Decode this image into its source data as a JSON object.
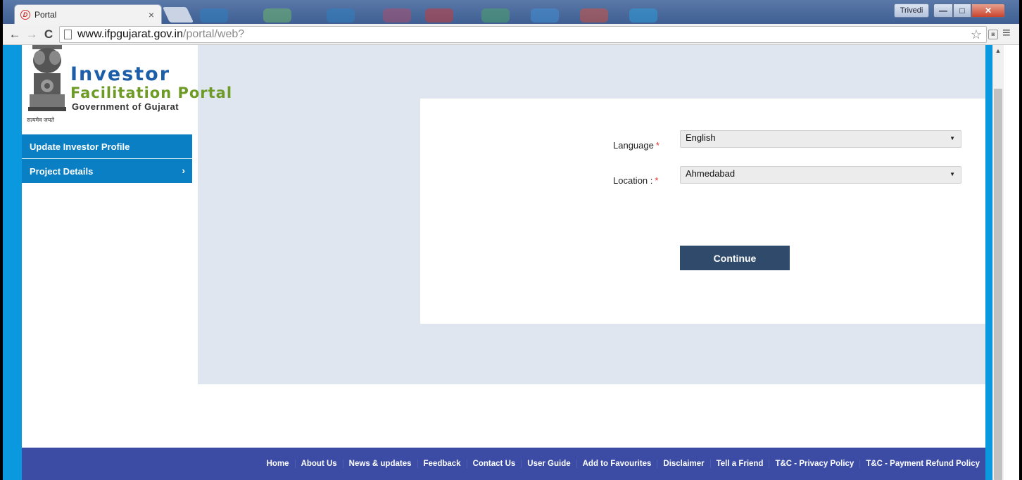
{
  "browser": {
    "tab_title": "Portal",
    "tab_favicon": "ifp-logo-icon",
    "profile_name": "Trivedi",
    "url_host": "www.ifpgujarat.gov.in",
    "url_path": "/portal/web?"
  },
  "header": {
    "logo_line1": "Investor",
    "logo_line2": "Facilitation Portal",
    "logo_line3": "Government of Gujarat",
    "motto": "सत्यमेव जयते"
  },
  "sidebar": {
    "items": [
      {
        "label": "Update Investor Profile"
      },
      {
        "label": "Project Details"
      }
    ]
  },
  "form": {
    "language_label": "Language",
    "language_value": "English",
    "location_label": "Location :",
    "location_value": "Ahmedabad",
    "required_marker": "*",
    "continue_label": "Continue"
  },
  "footer": {
    "links": [
      "Home",
      "About Us",
      "News & updates",
      "Feedback",
      "Contact Us",
      "User Guide",
      "Add to Favourites",
      "Disclaimer",
      "Tell a Friend",
      "T&C - Privacy Policy",
      "T&C - Payment Refund Policy"
    ]
  },
  "colors": {
    "sidebar_blue": "#0a7fc4",
    "edge_blue": "#0a98de",
    "footer_blue": "#3c4ca5",
    "button_navy": "#2f4a6b",
    "panel_bg": "#e0e6f0"
  }
}
